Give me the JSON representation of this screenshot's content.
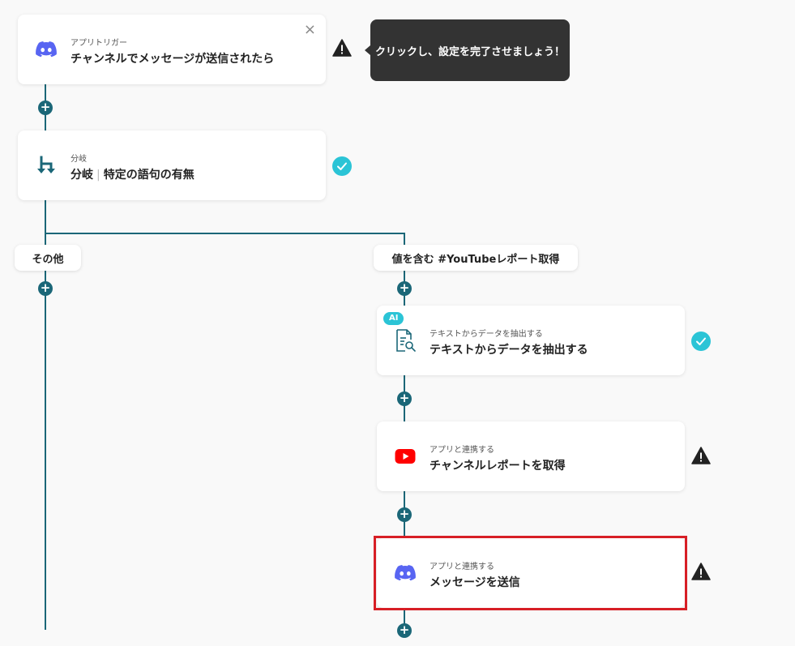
{
  "trigger": {
    "subtitle": "アプリトリガー",
    "title": "チャンネルでメッセージが送信されたら",
    "icon": "discord-icon",
    "close_label": "×"
  },
  "tooltip": {
    "text": "クリックし、設定を完了させましょう！"
  },
  "branch_step": {
    "subtitle": "分岐",
    "title_main": "分岐",
    "title_separator": "|",
    "title_detail": "特定の語句の有無",
    "icon": "branch-icon"
  },
  "branches": {
    "other_label": "その他",
    "contains_label": "値を含む #YouTubeレポート取得"
  },
  "extract_step": {
    "badge": "AI",
    "subtitle": "テキストからデータを抽出する",
    "title": "テキストからデータを抽出する",
    "icon": "document-search-icon"
  },
  "youtube_step": {
    "subtitle": "アプリと連携する",
    "title": "チャンネルレポートを取得",
    "icon": "youtube-icon"
  },
  "send_step": {
    "subtitle": "アプリと連携する",
    "title": "メッセージを送信",
    "icon": "discord-icon"
  },
  "plus_label": "+",
  "colors": {
    "line": "#1b6778",
    "check": "#2bc4d6",
    "warning": "#222222",
    "highlight": "#d71f26",
    "discord": "#5865f2",
    "youtube": "#ff0000"
  }
}
